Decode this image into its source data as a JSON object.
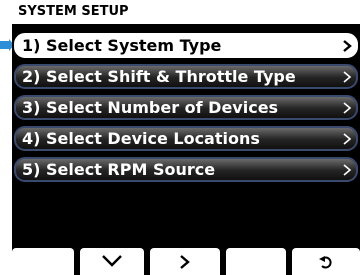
{
  "header": {
    "title": "SYSTEM SETUP"
  },
  "menu": {
    "items": [
      {
        "label": "1) Select System Type",
        "selected": true
      },
      {
        "label": "2) Select Shift & Throttle Type",
        "selected": false
      },
      {
        "label": "3) Select Number of Devices",
        "selected": false
      },
      {
        "label": "4) Select Device Locations",
        "selected": false
      },
      {
        "label": "5) Select RPM Source",
        "selected": false
      }
    ]
  },
  "softkeys": [
    {
      "icon": "blank"
    },
    {
      "icon": "chevron-down-icon"
    },
    {
      "icon": "chevron-right-icon"
    },
    {
      "icon": "blank"
    },
    {
      "icon": "back-arrow-icon"
    }
  ],
  "colors": {
    "accent": "#2f8fd6",
    "item_border": "#3a4a6e",
    "screen_bg": "#000000"
  }
}
